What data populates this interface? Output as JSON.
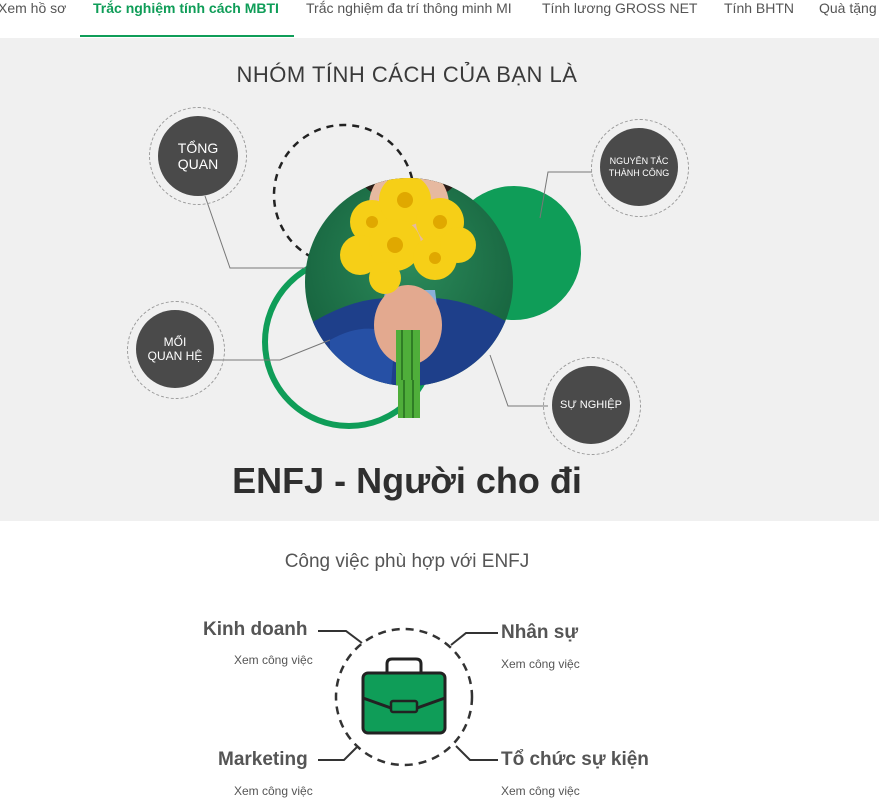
{
  "nav": {
    "tabs": [
      {
        "label": "Xem hồ sơ",
        "active": false
      },
      {
        "label": "Trắc nghiệm tính cách MBTI",
        "active": true
      },
      {
        "label": "Trắc nghiệm đa trí thông minh MI",
        "active": false
      },
      {
        "label": "Tính lương GROSS NET",
        "active": false
      },
      {
        "label": "Tính BHTN",
        "active": false
      },
      {
        "label": "Quà tặng",
        "active": false
      }
    ]
  },
  "hero": {
    "title": "NHÓM TÍNH CÁCH CỦA BẠN LÀ",
    "badges": {
      "overview": "TỔNG QUAN",
      "success": "NGUYÊN TẮC THÀNH CÔNG",
      "relationship": "MỐI QUAN HỆ",
      "career": "SỰ NGHIỆP"
    },
    "type_title": "ENFJ - Người cho đi"
  },
  "jobs": {
    "title": "Công việc phù hợp với ENFJ",
    "items": [
      {
        "name": "Kinh doanh",
        "link": "Xem công việc"
      },
      {
        "name": "Nhân sự",
        "link": "Xem công việc"
      },
      {
        "name": "Marketing",
        "link": "Xem công việc"
      },
      {
        "name": "Tổ chức sự kiện",
        "link": "Xem công việc"
      }
    ]
  },
  "colors": {
    "accent": "#0f9d58",
    "badge": "#4a4a4a",
    "hero_bg": "#f0f0f0"
  },
  "icons": [
    "briefcase-icon"
  ]
}
